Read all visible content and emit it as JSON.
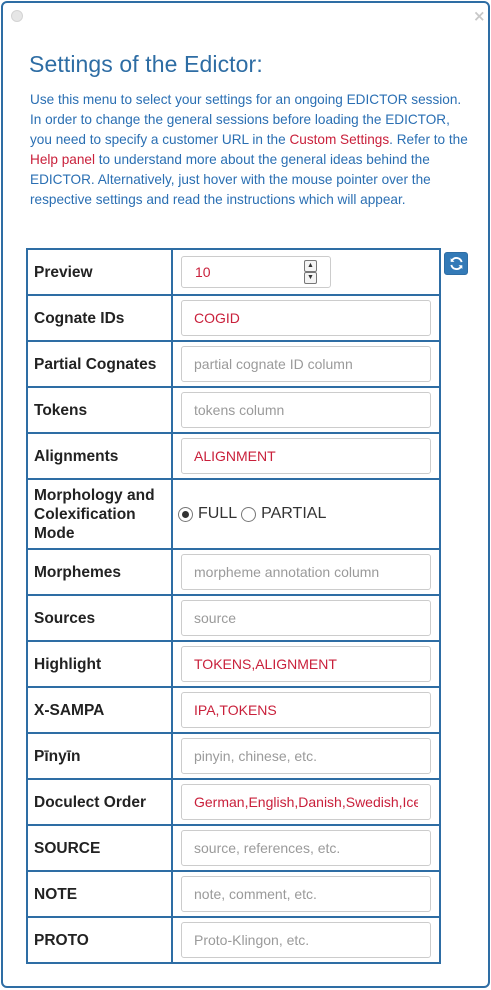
{
  "title": "Settings of the Edictor:",
  "intro": {
    "part1": "Use this menu to select your settings for an ongoing EDICTOR session. In order to change the general sessions before loading the EDICTOR, you need to specify a customer URL in the ",
    "link1": "Custom Settings",
    "part2": ". Refer to the ",
    "link2": "Help panel",
    "part3": " to understand more about the general ideas behind the EDICTOR. Alternatively, just hover with the mouse pointer over the respective settings and read the instructions which will appear."
  },
  "settings": {
    "preview": {
      "label": "Preview",
      "value": "10"
    },
    "cognate_ids": {
      "label": "Cognate IDs",
      "value": "COGID",
      "placeholder": ""
    },
    "partial_cognates": {
      "label": "Partial Cognates",
      "value": "",
      "placeholder": "partial cognate ID column"
    },
    "tokens": {
      "label": "Tokens",
      "value": "",
      "placeholder": "tokens column"
    },
    "alignments": {
      "label": "Alignments",
      "value": "ALIGNMENT",
      "placeholder": ""
    },
    "morphology_mode": {
      "label": "Morphology and Colexification Mode",
      "options": [
        "FULL",
        "PARTIAL"
      ],
      "selected": "FULL"
    },
    "morphemes": {
      "label": "Morphemes",
      "value": "",
      "placeholder": "morpheme annotation column"
    },
    "sources": {
      "label": "Sources",
      "value": "",
      "placeholder": "source"
    },
    "highlight": {
      "label": "Highlight",
      "value": "TOKENS,ALIGNMENT",
      "placeholder": ""
    },
    "xsampa": {
      "label": "X-SAMPA",
      "value": "IPA,TOKENS",
      "placeholder": ""
    },
    "pinyin": {
      "label": "Pīnyīn",
      "value": "",
      "placeholder": "pinyin, chinese, etc."
    },
    "doculect_order": {
      "label": "Doculect Order",
      "value": "German,English,Danish,Swedish,Icelandic",
      "placeholder": ""
    },
    "source": {
      "label": "SOURCE",
      "value": "",
      "placeholder": "source, references, etc."
    },
    "note": {
      "label": "NOTE",
      "value": "",
      "placeholder": "note, comment, etc."
    },
    "proto": {
      "label": "PROTO",
      "value": "",
      "placeholder": "Proto-Klingon, etc."
    }
  },
  "icons": {
    "close": "close-icon",
    "refresh": "refresh-icon"
  },
  "colors": {
    "accent": "#2e6da4",
    "link_red": "#c9203b",
    "button": "#337ab7"
  }
}
